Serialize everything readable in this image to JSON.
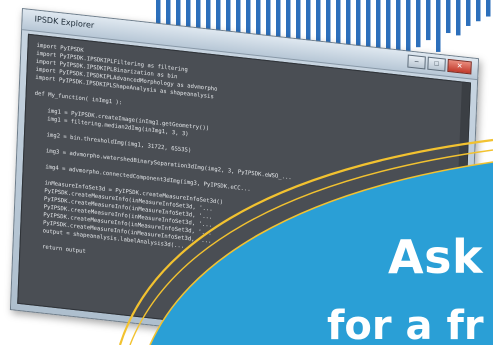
{
  "window": {
    "title": "IPSDK Explorer",
    "controls": [
      "–",
      "□",
      "✕"
    ]
  },
  "code": [
    "import PyIPSDK",
    "import PyIPSDK.IPSDKIPLFiltering as filtering",
    "import PyIPSDK.IPSDKIPLBinarization as bin",
    "import PyIPSDK.IPSDKIPLAdvancedMorphology as advmorpho",
    "import PyIPSDK.IPSDKIPLShapeAnalysis as shapeanalysis",
    "",
    "def My_function( inImg1 ):",
    "",
    "    img1 = PyIPSDK.createImage(inImg1.getGeometry())",
    "    img1 = filtering.median2dImg(inImg1, 3, 3)",
    "",
    "    img2 = bin.thresholdImg(img1, 31722, 65535)",
    "",
    "    img3 = advmorpho.watershedBinarySeparation3dImg(img2, 3, PyIPSDK.eWSO_...",
    "",
    "    img4 = advmorpho.connectedComponent3dImg(img3, PyIPSDK.eCC...",
    "",
    "    inMeasureInfoSet3d = PyIPSDK.createMeasureInfoSet3d()",
    "    PyIPSDK.createMeasureInfo(inMeasureInfoSet3d, '...",
    "    PyIPSDK.createMeasureInfo(inMeasureInfoSet3d, '...",
    "    PyIPSDK.createMeasureInfo(inMeasureInfoSet3d, '...",
    "    PyIPSDK.createMeasureInfo(inMeasureInfoSet3d, '...",
    "    PyIPSDK.createMeasureInfo(inMeasureInfoSet3d, '...",
    "    output = shapeanalysis.labelAnalysis3d(...",
    "",
    "    return output"
  ],
  "promo": {
    "line1": "Ask",
    "line2": "for a fr",
    "bg_color": "#2a9fd6",
    "ring_color": "#f2c230"
  },
  "chart_bg": {
    "bar_color": "#2c6fbb",
    "values": [
      62,
      78,
      70,
      88,
      74,
      95,
      84,
      100,
      90,
      72,
      96,
      86,
      80,
      92,
      70,
      88,
      76,
      66,
      82,
      74,
      60,
      92,
      70,
      54,
      66,
      48,
      40,
      34,
      44,
      28,
      30,
      22,
      18,
      14
    ]
  }
}
